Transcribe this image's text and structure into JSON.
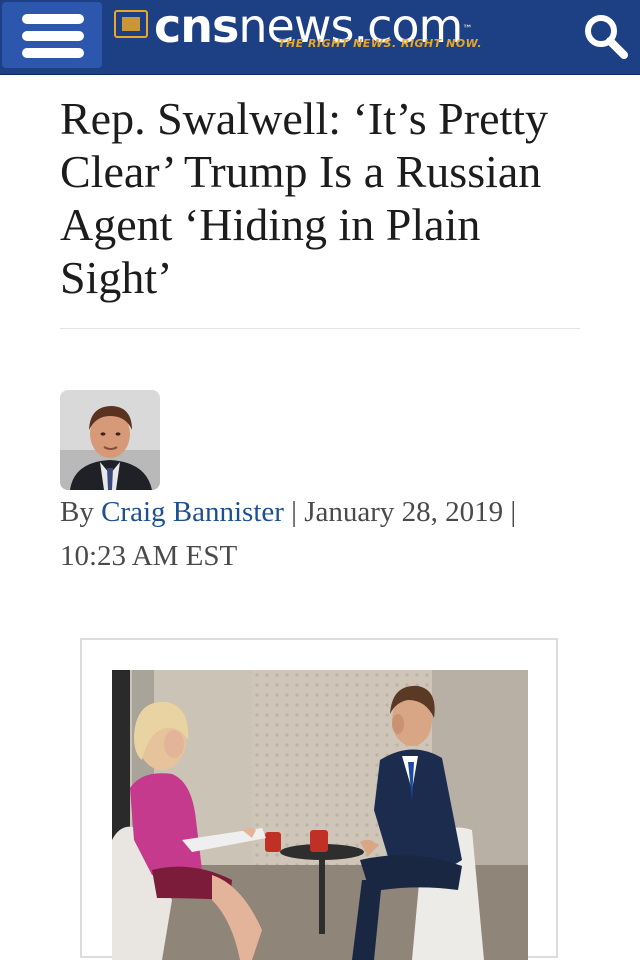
{
  "header": {
    "logo": {
      "word_bold": "cns",
      "word_light": "news.com",
      "trademark": "™",
      "tagline": "THE RIGHT NEWS. RIGHT NOW."
    },
    "menu_icon": "hamburger-menu-icon",
    "search_icon": "search-icon",
    "colors": {
      "background": "#1d3f84",
      "menu_button": "#2c57ad",
      "accent": "#e8a62a"
    }
  },
  "article": {
    "headline": "Rep. Swalwell: ‘It’s Pretty Clear’ Trump Is a Russian Agent ‘Hiding in Plain Sight’",
    "byline": {
      "prefix": "By",
      "author": "Craig Bannister",
      "separator": "|",
      "date": "January 28, 2019",
      "time": "10:23 AM EST"
    },
    "author_link_color": "#1e4f8e"
  }
}
